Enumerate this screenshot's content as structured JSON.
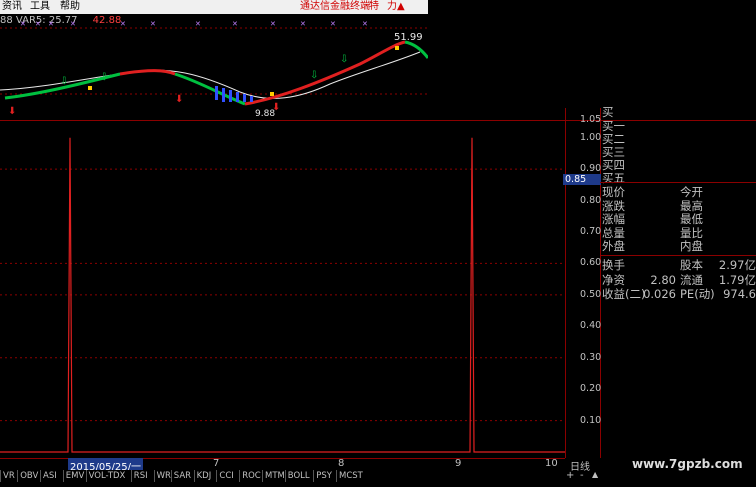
{
  "menu": {
    "item1": "资讯",
    "item2": "工具",
    "item3": "帮助"
  },
  "brand": {
    "name": "通达信金融终端",
    "extra1": "特",
    "extra2": "力",
    "extra_icon": "up-arrow"
  },
  "top_indicators": {
    "prefix": "88",
    "var5_label": "VAR5:",
    "var5_value": "25.77",
    "var_extra": "42.88"
  },
  "top_chart": {
    "price_high": "51.99",
    "price_low": "9.88"
  },
  "main_chart": {
    "chart_data": {
      "type": "line",
      "y_ticks": [
        "1.00",
        "0.90",
        "0.80",
        "0.70",
        "0.60",
        "0.50",
        "0.40",
        "0.30",
        "0.20",
        "0.10"
      ],
      "top_tick": "1.05",
      "ylim": [
        0,
        1.05
      ],
      "current_value": "0.85",
      "series": [
        {
          "values": [
            0,
            0,
            1.0,
            0,
            0,
            0,
            0,
            0,
            0,
            0,
            0,
            0,
            0,
            0,
            0,
            0,
            0,
            1.0,
            0,
            0
          ]
        }
      ]
    }
  },
  "right_panel": {
    "buy_rows": [
      "买一",
      "买二",
      "买三",
      "买四",
      "买五"
    ],
    "top_fragment": "买",
    "stats_left": [
      "现价",
      "涨跌",
      "涨幅",
      "总量",
      "外盘"
    ],
    "stats_mid": [
      "今开",
      "最高",
      "最低",
      "量比",
      "内盘"
    ],
    "fund_rows": [
      {
        "l1": "换手",
        "v1": "",
        "l2": "股本",
        "v2": "2.97亿"
      },
      {
        "l1": "净资",
        "v1": "2.80",
        "l2": "流通",
        "v2": "1.79亿"
      },
      {
        "l1": "收益(二)",
        "v1": "0.026",
        "l2": "PE(动)",
        "v2": "974.6"
      }
    ]
  },
  "x_axis": {
    "selected_date": "2015/05/25/一",
    "ticks": [
      "7",
      "8",
      "9",
      "10"
    ],
    "period": "日线"
  },
  "tabs": [
    "VR",
    "OBV",
    "ASI",
    "EMV",
    "VOL-TDX",
    "RSI",
    "WR",
    "SAR",
    "KDJ",
    "CCI",
    "ROC",
    "MTM",
    "BOLL",
    "PSY",
    "MCST"
  ],
  "tab_controls": {
    "plus": "+",
    "minus": "-",
    "arrow": "▲"
  },
  "watermark": "www.7gpzb.com"
}
